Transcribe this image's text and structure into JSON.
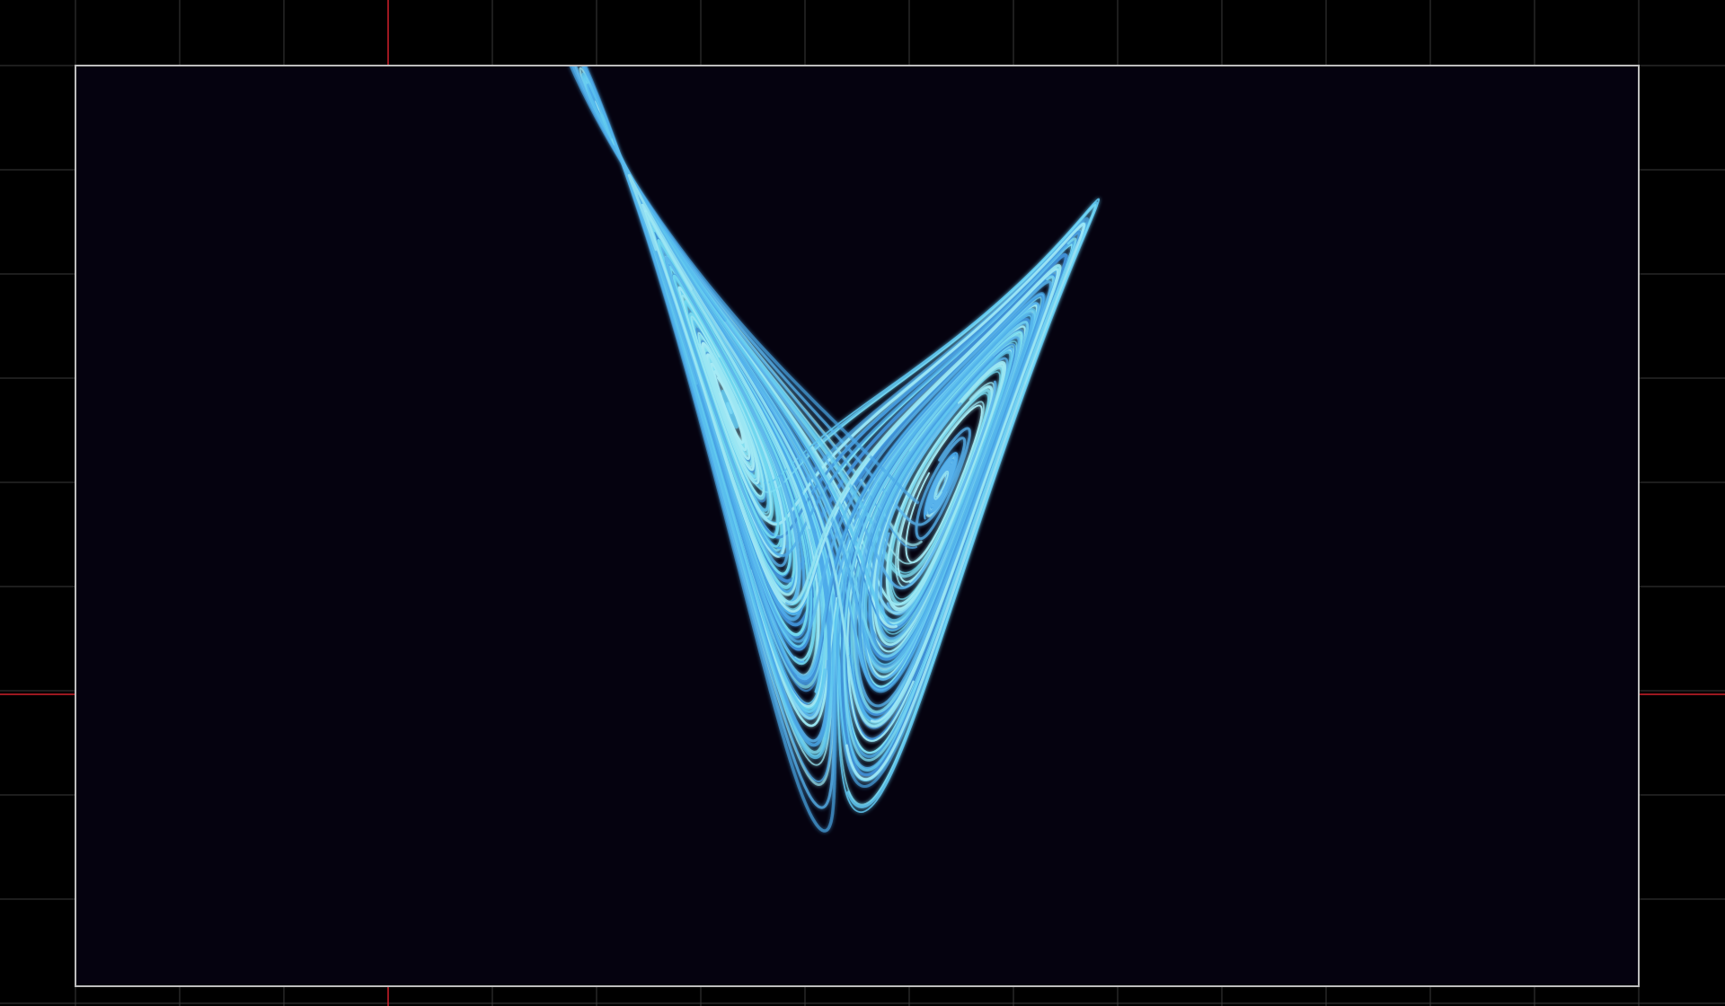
{
  "colors": {
    "page_background": "#000000",
    "grid_line": "#3a3a3a",
    "axis_marker": "#d0202a",
    "canvas_background": "#05020f",
    "canvas_border": "#bdbdbd",
    "trail_colors": [
      "#5fc6f0",
      "#7fe0f5",
      "#4aa8e8",
      "#9ae6f2",
      "#3f8fd6",
      "#6fd6ee",
      "#a9ecf6",
      "#58b4ee"
    ]
  },
  "scene": {
    "description_shown": false,
    "trail_count": 60,
    "attractor_style": "tangled streamlines"
  }
}
